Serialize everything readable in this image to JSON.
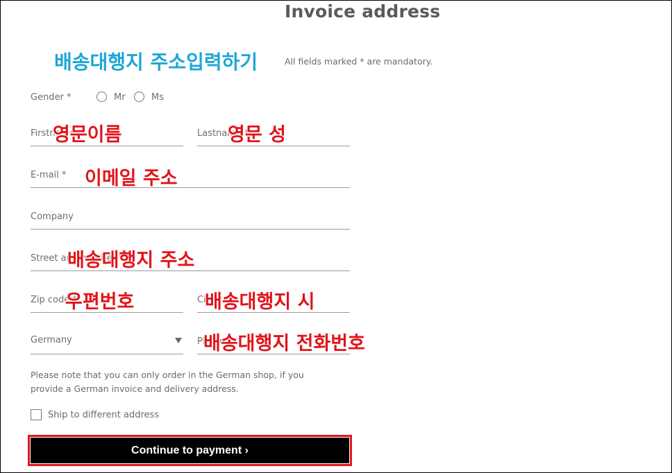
{
  "page": {
    "title": "Invoice address",
    "mandatory_note": "All fields marked * are mandatory."
  },
  "annotations": {
    "heading": "배송대행지 주소입력하기",
    "firstname": "영문이름",
    "lastname": "영문 성",
    "email": "이메일 주소",
    "street": "배송대행지 주소",
    "zip": "우편번호",
    "city": "배송대행지 시",
    "phone": "배송대행지 전화번호",
    "colors": {
      "cyan": "#1ea6d8",
      "red": "#e0141b"
    }
  },
  "form": {
    "gender_label": "Gender *",
    "gender_options": [
      "Mr",
      "Ms"
    ],
    "firstname_placeholder": "Firstname *",
    "lastname_placeholder": "Lastname *",
    "email_placeholder": "E-mail *",
    "company_placeholder": "Company",
    "street_placeholder": "Street and number *",
    "zip_placeholder": "Zip code *",
    "city_placeholder": "City *",
    "country_value": "Germany",
    "phone_placeholder": "Phone",
    "info_text": "Please note that you can only order in the German shop, if you provide a German invoice and delivery address.",
    "ship_label": "Ship to different address",
    "continue_label": "Continue to payment ›",
    "button_color": "#000000",
    "highlight_color": "#e0141b"
  },
  "icons": {
    "dropdown": "chevron-down-icon",
    "radio": "radio-icon",
    "checkbox": "checkbox-icon"
  }
}
